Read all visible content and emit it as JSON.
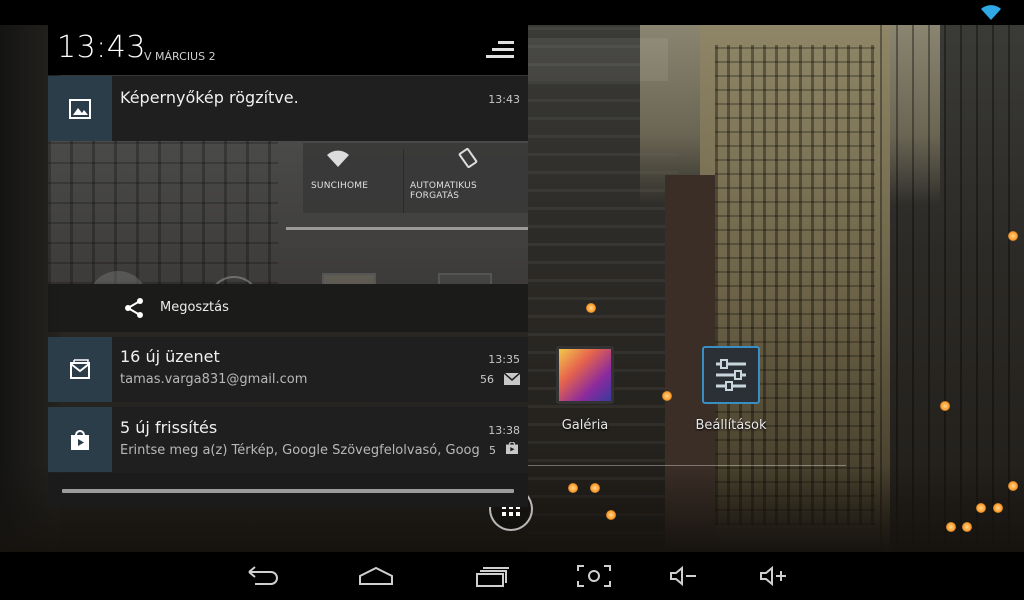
{
  "status_bar": {
    "wifi_icon": "wifi-icon"
  },
  "notification_shade": {
    "clock": "13:43",
    "date": "V MÁRCIUS 2",
    "quick_settings_icon": "quick-settings-icon",
    "notifications": [
      {
        "id": "screenshot",
        "icon": "image-icon",
        "title": "Képernyőkép rögzítve.",
        "time": "13:43",
        "preview": {
          "tiles": [
            "SUNCIHOME",
            "AUTOMATIKUS FORGATÁS"
          ]
        },
        "action": {
          "icon": "share-icon",
          "label": "Megosztás"
        }
      },
      {
        "id": "gmail",
        "icon": "gmail-icon",
        "title": "16 új üzenet",
        "subtitle": "tamas.varga831@gmail.com",
        "time": "13:35",
        "count": "56"
      },
      {
        "id": "play-store",
        "icon": "play-store-icon",
        "title": "5 új frissítés",
        "subtitle": "Érintse meg a(z) Térkép, Google Szövegfelolvasó, Google k",
        "time": "13:38",
        "count": "5"
      }
    ]
  },
  "home_screen": {
    "apps": [
      {
        "label": "Galéria",
        "icon": "gallery-icon"
      },
      {
        "label": "Beállítások",
        "icon": "settings-icon"
      }
    ],
    "all_apps_icon": "all-apps-icon"
  },
  "nav_bar": {
    "buttons": [
      "back-icon",
      "home-icon",
      "recent-apps-icon",
      "screenshot-icon",
      "volume-down-icon",
      "volume-up-icon"
    ]
  },
  "colors": {
    "shade_bg": "#1f1f1f",
    "icon_box": "#2b3d48",
    "accent_blue": "#3b8ec2"
  }
}
